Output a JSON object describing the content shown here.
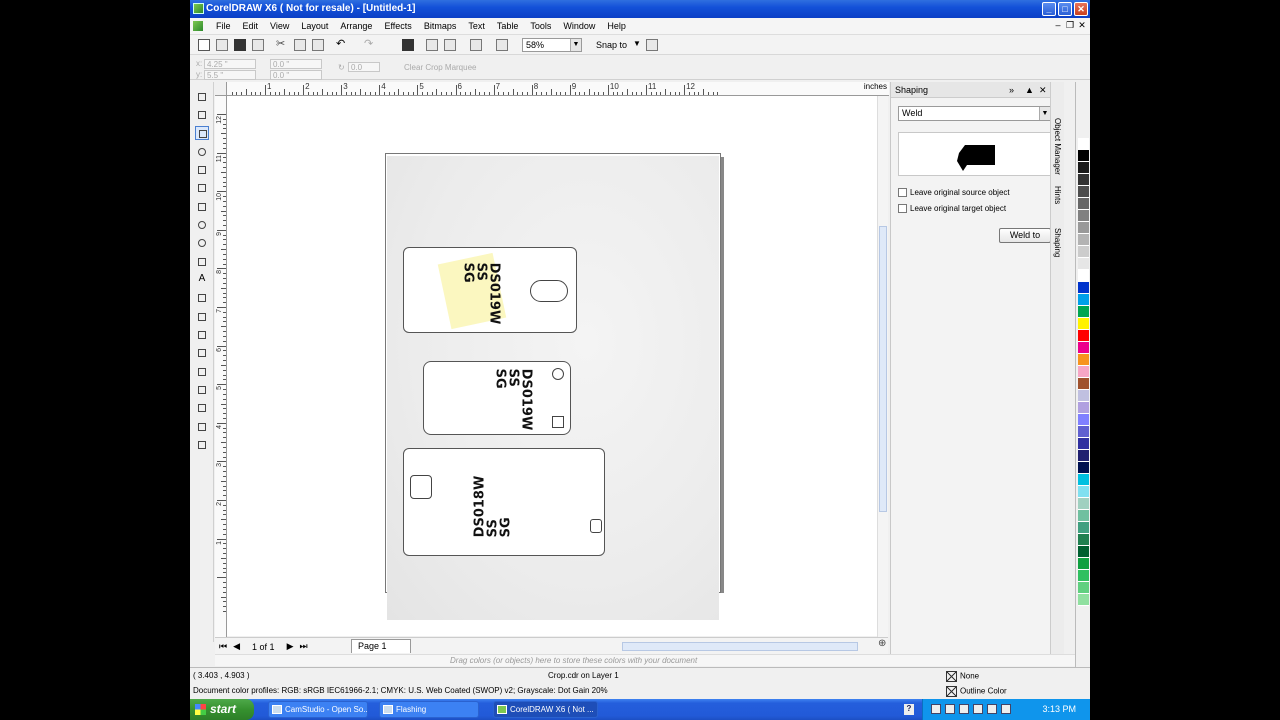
{
  "window": {
    "title": "CorelDRAW X6 ( Not for resale) - [Untitled-1]",
    "min": "_",
    "max": "□",
    "close": "✕"
  },
  "menu": [
    "File",
    "Edit",
    "View",
    "Layout",
    "Arrange",
    "Effects",
    "Bitmaps",
    "Text",
    "Table",
    "Tools",
    "Window",
    "Help"
  ],
  "toolbar": {
    "zoom": "58%",
    "snap_to": "Snap to"
  },
  "propbar": {
    "x": "4.25 \"",
    "y": "5.5 \"",
    "w": "0.0 \"",
    "h": "0.0 \"",
    "angle": "0.0",
    "clear_crop": "Clear Crop Marquee",
    "x_label": "x:",
    "y_label": "y:"
  },
  "ruler": {
    "units": "inches",
    "h_labels": [
      "1",
      "2",
      "3",
      "4",
      "5",
      "6",
      "7",
      "8",
      "9",
      "10",
      "11",
      "12"
    ],
    "v_labels": [
      "12",
      "11",
      "10",
      "9",
      "8",
      "7",
      "6",
      "5",
      "4",
      "3",
      "2",
      "1"
    ]
  },
  "canvas": {
    "card1_text": "DS019W\nSS\nSG",
    "card2_text": "DS019W\nSS\nSG",
    "card3_text": "DS018W\nSS\nSG"
  },
  "pager": {
    "count": "1 of 1",
    "page_tab": "Page 1"
  },
  "colorwell_hint": "Drag colors (or objects) here to store these colors with your document",
  "status": {
    "cursor": "( 3.403 , 4.903 )",
    "layer": "Crop.cdr on Layer 1",
    "profile": "Document color profiles: RGB: sRGB IEC61966-2.1; CMYK: U.S. Web Coated (SWOP) v2; Grayscale: Dot Gain 20%",
    "fill": "None",
    "outline": "Outline Color"
  },
  "docker": {
    "title": "Shaping",
    "mode": "Weld",
    "leave_source": "Leave original source object",
    "leave_target": "Leave original target object",
    "weld_button": "Weld to",
    "tabs": [
      "Object Manager",
      "Hints",
      "Shaping"
    ]
  },
  "palette": [
    "#ffffff",
    "#000000",
    "#1a1a1a",
    "#333333",
    "#4d4d4d",
    "#666666",
    "#808080",
    "#999999",
    "#b3b3b3",
    "#cccccc",
    "#e6e6e6",
    "#ffffff",
    "#0033cc",
    "#00a0e9",
    "#00a651",
    "#fff200",
    "#ff0000",
    "#ec008c",
    "#f7941d",
    "#f6a6c5",
    "#a0522d",
    "#c0c0e0",
    "#b0a0e0",
    "#8080ff",
    "#6060d0",
    "#3030a0",
    "#202070",
    "#001050",
    "#00c0e0",
    "#80e0f0",
    "#a0d0c0",
    "#70c0a0",
    "#40a080",
    "#208050",
    "#006030",
    "#10a040",
    "#30c060",
    "#60d080",
    "#90e0a0"
  ],
  "taskbar": {
    "start": "start",
    "tasks": [
      "CamStudio - Open So...",
      "Flashing",
      "CorelDRAW X6 ( Not ..."
    ],
    "clock": "3:13 PM",
    "help": "?"
  }
}
